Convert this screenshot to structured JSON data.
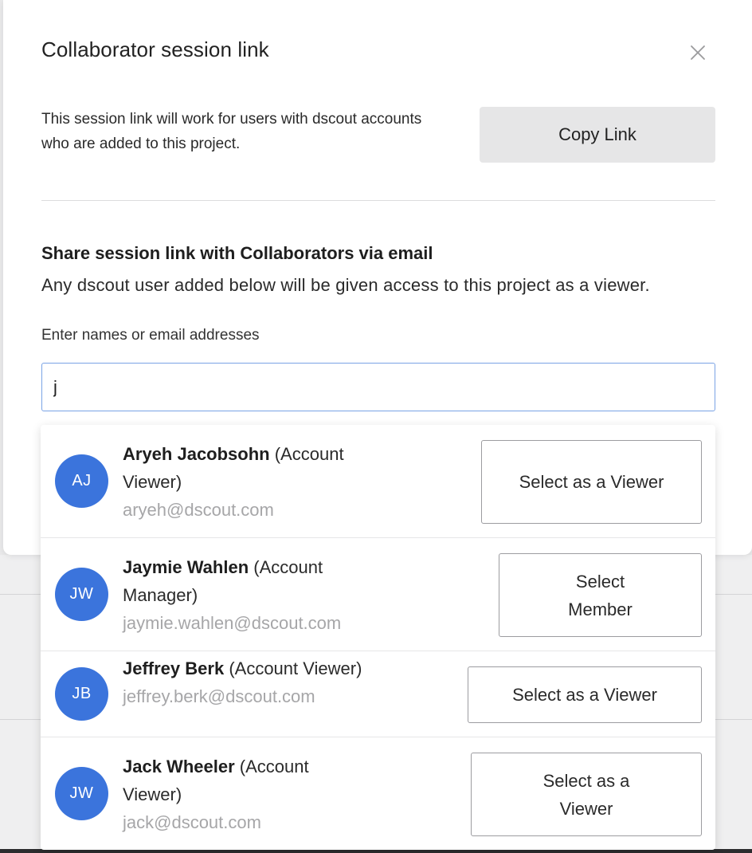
{
  "modal": {
    "title": "Collaborator session link",
    "description": "This session link will work for users with dscout accounts who are added to this project.",
    "copy_button": "Copy Link",
    "section_title": "Share session link with Collaborators via email",
    "section_description": "Any dscout user added below will be given access to this project as a viewer.",
    "field_label": "Enter names or email addresses",
    "field_value": "j"
  },
  "results": [
    {
      "initials": "AJ",
      "name": "Aryeh Jacobsohn",
      "role": "(Account Viewer)",
      "email": "aryeh@dscout.com",
      "action": "Select as a Viewer"
    },
    {
      "initials": "JW",
      "name": "Jaymie Wahlen",
      "role": "(Account Manager)",
      "email": "jaymie.wahlen@dscout.com",
      "action": "Select Member"
    },
    {
      "initials": "JB",
      "name": "Jeffrey Berk",
      "role": "(Account Viewer)",
      "email": "jeffrey.berk@dscout.com",
      "action": "Select as a Viewer"
    },
    {
      "initials": "JW",
      "name": "Jack Wheeler",
      "role": "(Account Viewer)",
      "email": "jack@dscout.com",
      "action": "Select as a Viewer"
    }
  ],
  "colors": {
    "avatar": "#3b74dc",
    "input_focus_border": "#7aa3e5",
    "email_text": "#a6a6a8"
  },
  "icons": {
    "close": "close-icon"
  }
}
